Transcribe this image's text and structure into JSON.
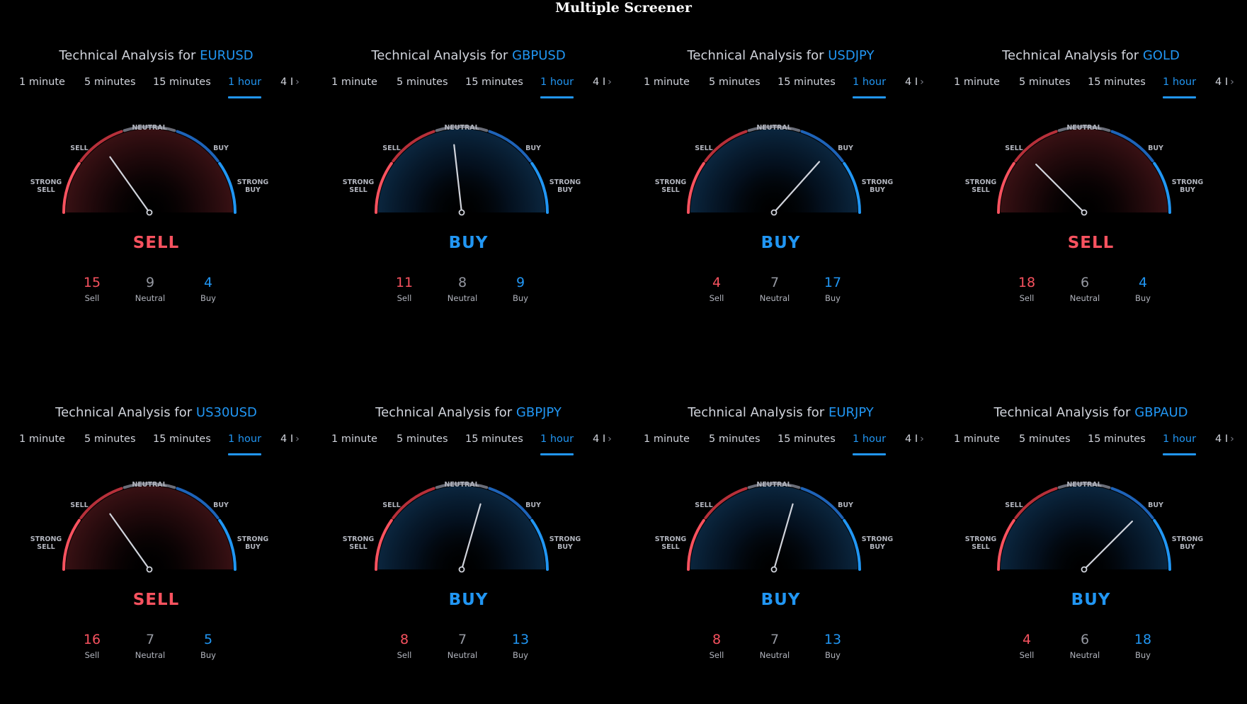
{
  "page_title": "Multiple Screener",
  "title_prefix": "Technical Analysis for",
  "tabs": [
    "1 minute",
    "5 minutes",
    "15 minutes",
    "1 hour"
  ],
  "tab_more": "4 I",
  "active_tab": "1 hour",
  "gauge_labels": {
    "strong_sell": "STRONG SELL",
    "sell": "SELL",
    "neutral": "NEUTRAL",
    "buy": "BUY",
    "strong_buy": "STRONG BUY"
  },
  "count_labels": {
    "sell": "Sell",
    "neutral": "Neutral",
    "buy": "Buy"
  },
  "colors": {
    "sell": "#f7525f",
    "buy": "#2196f3",
    "neutral": "#9598a1",
    "background": "#000000"
  },
  "logo_icon": "tradingview-logo-icon",
  "widgets": [
    {
      "symbol": "EURUSD",
      "signal": "SELL",
      "sell": "15",
      "neutral": "9",
      "buy": "4"
    },
    {
      "symbol": "GBPUSD",
      "signal": "BUY",
      "sell": "11",
      "neutral": "8",
      "buy": "9"
    },
    {
      "symbol": "USDJPY",
      "signal": "BUY",
      "sell": "4",
      "neutral": "7",
      "buy": "17"
    },
    {
      "symbol": "GOLD",
      "signal": "SELL",
      "sell": "18",
      "neutral": "6",
      "buy": "4"
    },
    {
      "symbol": "US30USD",
      "signal": "SELL",
      "sell": "16",
      "neutral": "7",
      "buy": "5"
    },
    {
      "symbol": "GBPJPY",
      "signal": "BUY",
      "sell": "8",
      "neutral": "7",
      "buy": "13"
    },
    {
      "symbol": "EURJPY",
      "signal": "BUY",
      "sell": "8",
      "neutral": "7",
      "buy": "13"
    },
    {
      "symbol": "GBPAUD",
      "signal": "BUY",
      "sell": "4",
      "neutral": "6",
      "buy": "18"
    }
  ]
}
